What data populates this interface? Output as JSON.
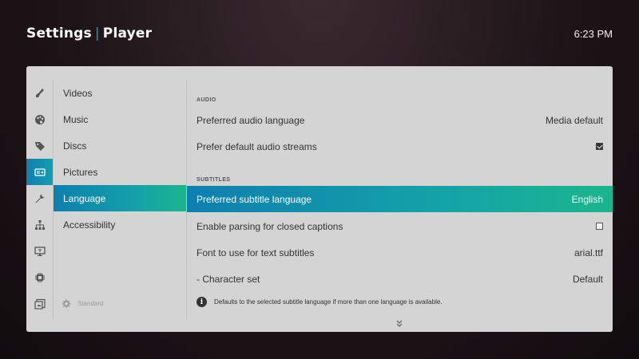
{
  "header": {
    "section": "Settings",
    "separator": "|",
    "page": "Player",
    "time": "6:23 PM"
  },
  "sidebar": {
    "icons": [
      {
        "name": "broom-icon",
        "active": false
      },
      {
        "name": "palette-icon",
        "active": false
      },
      {
        "name": "tag-icon",
        "active": false
      },
      {
        "name": "player-icon",
        "active": true
      },
      {
        "name": "wrench-icon",
        "active": false
      },
      {
        "name": "network-icon",
        "active": false
      },
      {
        "name": "pc-icon",
        "active": false
      },
      {
        "name": "chip-icon",
        "active": false
      },
      {
        "name": "addons-icon",
        "active": false
      }
    ],
    "categories": [
      {
        "label": "Videos"
      },
      {
        "label": "Music"
      },
      {
        "label": "Discs"
      },
      {
        "label": "Pictures"
      },
      {
        "label": "Language",
        "active": true
      },
      {
        "label": "Accessibility"
      }
    ],
    "level_label": "Standard"
  },
  "settings": {
    "audio_header": "AUDIO",
    "audio_rows": [
      {
        "label": "Preferred audio language",
        "value": "Media default"
      },
      {
        "label": "Prefer default audio streams",
        "checked": true
      }
    ],
    "subtitles_header": "SUBTITLES",
    "subtitle_rows": [
      {
        "label": "Preferred subtitle language",
        "value": "English",
        "active": true
      },
      {
        "label": "Enable parsing for closed captions",
        "checked": false
      },
      {
        "label": "Font to use for text subtitles",
        "value": "arial.ttf"
      },
      {
        "label": "- Character set",
        "value": "Default"
      }
    ],
    "info_text": "Defaults to the selected subtitle language if more than one language is available."
  },
  "colors": {
    "accent_start": "#0e7fb0",
    "accent_end": "#1cb58d",
    "panel_bg": "#d4d4d4"
  }
}
